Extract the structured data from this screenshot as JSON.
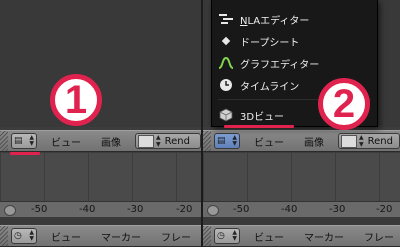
{
  "left_pane": {
    "badge": "1",
    "header": {
      "view": "ビュー",
      "image": "画像",
      "render": "Rend"
    },
    "ruler": {
      "ticks": [
        "-50",
        "-40",
        "-30",
        "-20"
      ]
    },
    "footer": {
      "view": "ビュー",
      "marker": "マーカー",
      "frame": "フレー"
    }
  },
  "right_pane": {
    "badge": "2",
    "header": {
      "view": "ビュー",
      "image": "画像",
      "render": "Rend"
    },
    "ruler": {
      "ticks": [
        "-50",
        "-40",
        "-30",
        "-20"
      ]
    },
    "footer": {
      "view": "ビュー",
      "marker": "マーカー",
      "frame": "フレー"
    }
  },
  "editor_menu": {
    "items": [
      {
        "label_first": "N",
        "label_rest": "LAエディター",
        "icon": "nla-icon"
      },
      {
        "label": "ドープシート",
        "icon": "dopesheet-icon"
      },
      {
        "label": "グラフエディター",
        "icon": "graph-icon"
      },
      {
        "label": "タイムライン",
        "icon": "timeline-clock-icon"
      },
      {
        "label": "3Dビュー",
        "icon": "cube-icon"
      }
    ]
  },
  "colors": {
    "highlight": "#e0224f",
    "header": "#7c7c7c",
    "menu_bg": "#181818"
  }
}
